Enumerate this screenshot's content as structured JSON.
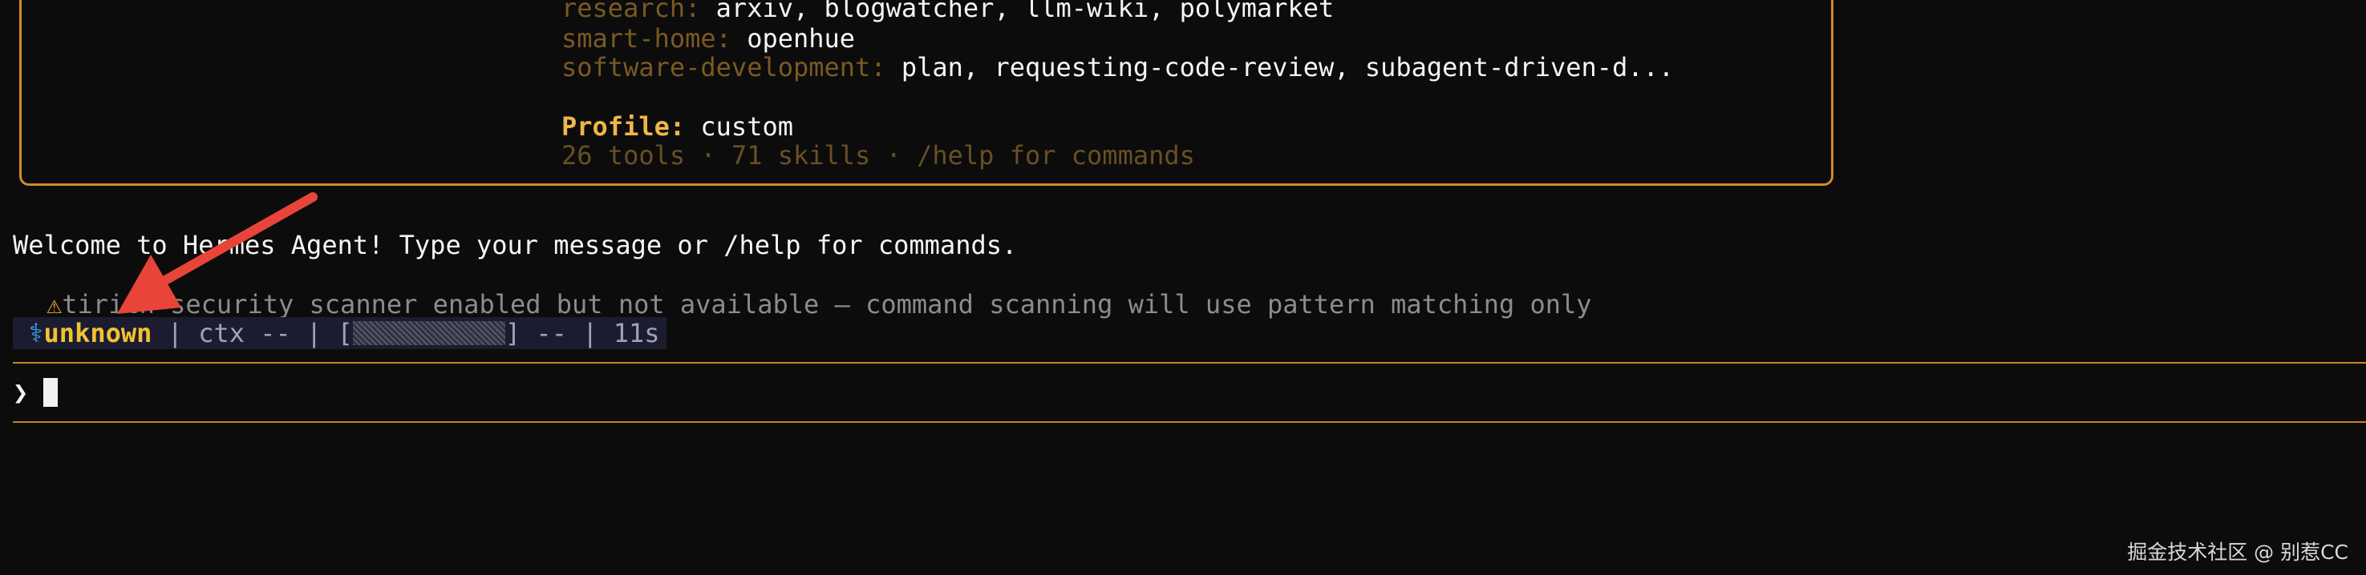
{
  "banner": {
    "categories": [
      {
        "label": "research:",
        "value": "arxiv, blogwatcher, llm-wiki, polymarket"
      },
      {
        "label": "smart-home:",
        "value": "openhue"
      },
      {
        "label": "software-development:",
        "value": "plan, requesting-code-review, subagent-driven-d..."
      }
    ],
    "profile_label": "Profile:",
    "profile_value": "custom",
    "stats": "26 tools · 71 skills · /help for commands"
  },
  "welcome_message": "Welcome to Hermes Agent! Type your message or /help for commands.",
  "warning": {
    "icon": "warning-icon",
    "text": "tirith security scanner enabled but not available — command scanning will use pattern matching only"
  },
  "status_bar": {
    "icon": "caduceus-icon",
    "model": "unknown",
    "ctx_label": "| ctx -- | [",
    "ctx_close": "] -- |",
    "elapsed": "11s"
  },
  "prompt": {
    "symbol": "❯"
  },
  "watermark": "掘金技术社区 @ 别惹CC",
  "colors": {
    "accent_border": "#d28a2e",
    "profile": "#f0b54a",
    "model": "#f2c230",
    "annotation_arrow": "#e8443a"
  }
}
